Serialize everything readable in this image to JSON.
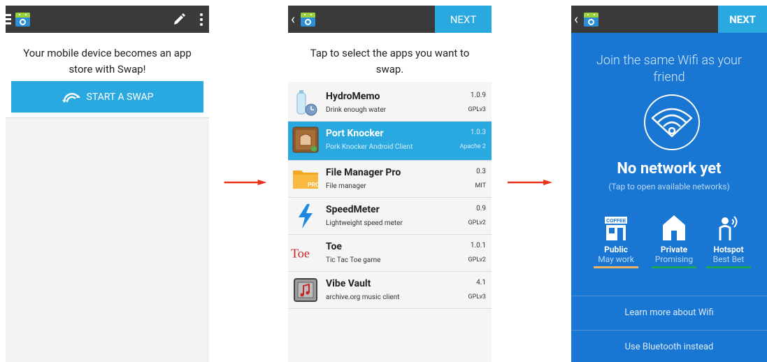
{
  "panel1": {
    "intro_text": "Your mobile device becomes an app store with Swap!",
    "start_button": "START A SWAP"
  },
  "panel2": {
    "next_label": "NEXT",
    "instruction": "Tap to select the apps you want to swap.",
    "apps": [
      {
        "name": "HydroMemo",
        "summary": "Drink enough water",
        "version": "1.0.9",
        "license": "GPLv3"
      },
      {
        "name": "Port Knocker",
        "summary": "Pork Knocker Android Client",
        "version": "1.0.3",
        "license": "Apache 2"
      },
      {
        "name": "File Manager Pro",
        "summary": "File manager",
        "version": "0.3",
        "license": "MIT"
      },
      {
        "name": "SpeedMeter",
        "summary": "Lightweight speed meter",
        "version": "0.9",
        "license": "GPLv2"
      },
      {
        "name": "Toe",
        "summary": "Tic Tac Toe game",
        "version": "1.0.1",
        "license": "GPLv2"
      },
      {
        "name": "Vibe Vault",
        "summary": "archive.org music client",
        "version": "4.1",
        "license": "GPLv3"
      }
    ],
    "icon_labels": {
      "file_manager": "PRO",
      "toe": "Toe"
    }
  },
  "panel3": {
    "next_label": "NEXT",
    "title": "Join the same Wifi as your friend",
    "status": "No network yet",
    "status_hint": "(Tap to open available networks)",
    "options": [
      {
        "title": "Public",
        "subtitle": "May work",
        "icon": "coffee-shop-icon",
        "icon_text": "COFFEE",
        "color": "#f0b25a"
      },
      {
        "title": "Private",
        "subtitle": "Promising",
        "icon": "house-icon",
        "color": "#1aa55a"
      },
      {
        "title": "Hotspot",
        "subtitle": "Best Bet",
        "icon": "person-hotspot-icon",
        "color": "#1aa55a"
      }
    ],
    "learn_more": "Learn more about Wifi",
    "bluetooth": "Use Bluetooth instead"
  },
  "colors": {
    "accent": "#29a9e0",
    "action_bar": "#3a3a3a",
    "wifi_bg": "#1976d2",
    "arrow": "#e8331c"
  }
}
